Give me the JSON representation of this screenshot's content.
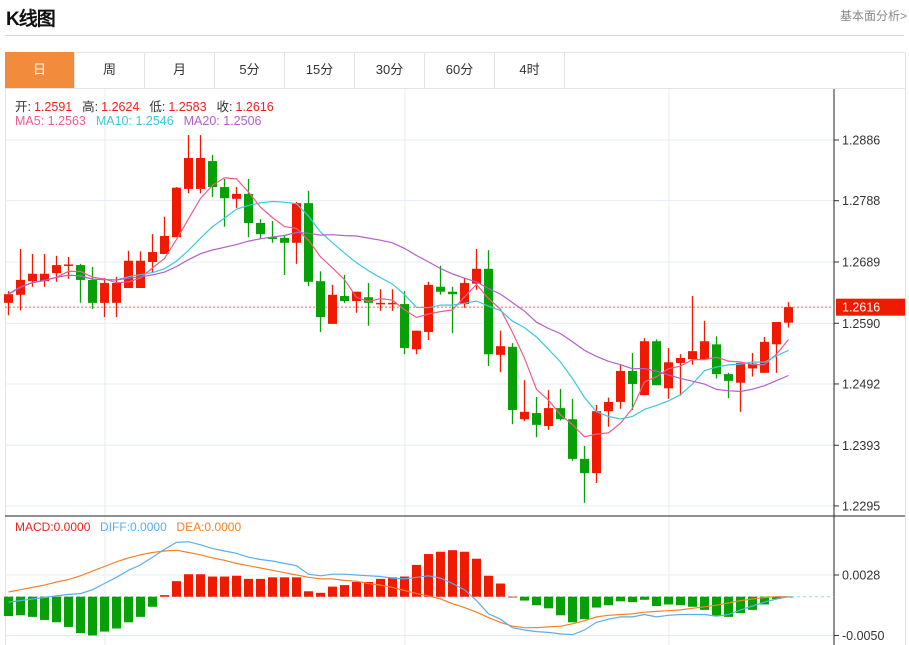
{
  "header": {
    "title": "K线图",
    "more_link": "基本面分析>"
  },
  "tabs": [
    {
      "label": "日",
      "active": true
    },
    {
      "label": "周"
    },
    {
      "label": "月"
    },
    {
      "label": "5分"
    },
    {
      "label": "15分"
    },
    {
      "label": "30分"
    },
    {
      "label": "60分"
    },
    {
      "label": "4时"
    }
  ],
  "ohlc_legend": {
    "open_label": "开:",
    "open": "1.2591",
    "high_label": "高:",
    "high": "1.2624",
    "low_label": "低:",
    "low": "1.2583",
    "close_label": "收:",
    "close": "1.2616"
  },
  "ma_legend": {
    "ma5": "MA5: 1.2563",
    "ma10": "MA10: 1.2546",
    "ma20": "MA20: 1.2506"
  },
  "macd_legend": {
    "macd": "MACD:0.0000",
    "diff": "DIFF:0.0000",
    "dea": "DEA:0.0000"
  },
  "colors": {
    "up": "#f01a00",
    "down": "#07a007",
    "ma5": "#ee5d8c",
    "ma10": "#3cc8dc",
    "ma20": "#b35fc8",
    "diff": "#5aaeef",
    "dea": "#f5822a",
    "accent": "#f38b3c"
  },
  "chart_data": [
    {
      "type": "candlestick",
      "title": "K线图 日",
      "current_price": "1.2616",
      "y_ticks": [
        "1.2886",
        "1.2788",
        "1.2689",
        "1.2590",
        "1.2492",
        "1.2393",
        "1.2295"
      ],
      "ylim": [
        1.2279,
        1.302
      ],
      "ma_periods": [
        5,
        10,
        20
      ],
      "candles": [
        [
          1.2623,
          1.2642,
          1.2603,
          1.2637
        ],
        [
          1.2636,
          1.271,
          1.2611,
          1.266
        ],
        [
          1.2658,
          1.2702,
          1.2649,
          1.267
        ],
        [
          1.2658,
          1.2702,
          1.2649,
          1.267
        ],
        [
          1.2671,
          1.2699,
          1.2657,
          1.2684
        ],
        [
          1.2684,
          1.2697,
          1.2662,
          1.2685
        ],
        [
          1.2684,
          1.2686,
          1.2623,
          1.266
        ],
        [
          1.266,
          1.2681,
          1.2613,
          1.2623
        ],
        [
          1.2623,
          1.2663,
          1.26,
          1.2655
        ],
        [
          1.2623,
          1.2665,
          1.26,
          1.2655
        ],
        [
          1.2647,
          1.2707,
          1.2647,
          1.2691
        ],
        [
          1.2647,
          1.2706,
          1.2647,
          1.2691
        ],
        [
          1.2689,
          1.2734,
          1.2671,
          1.2705
        ],
        [
          1.2702,
          1.2762,
          1.2702,
          1.2731
        ],
        [
          1.2729,
          1.281,
          1.2729,
          1.2809
        ],
        [
          1.2807,
          1.2894,
          1.28,
          1.2857
        ],
        [
          1.2807,
          1.2894,
          1.28,
          1.2857
        ],
        [
          1.2852,
          1.2862,
          1.2794,
          1.281
        ],
        [
          1.281,
          1.2823,
          1.2746,
          1.2792
        ],
        [
          1.2791,
          1.281,
          1.2776,
          1.2799
        ],
        [
          1.2799,
          1.2823,
          1.2729,
          1.2752
        ],
        [
          1.2752,
          1.2758,
          1.2726,
          1.2734
        ],
        [
          1.2729,
          1.2755,
          1.272,
          1.2726
        ],
        [
          1.2728,
          1.2733,
          1.2668,
          1.272
        ],
        [
          1.272,
          1.2786,
          1.2686,
          1.2784
        ],
        [
          1.2784,
          1.2804,
          1.265,
          1.2657
        ],
        [
          1.2658,
          1.2674,
          1.2576,
          1.26
        ],
        [
          1.2589,
          1.2652,
          1.2589,
          1.2636
        ],
        [
          1.2634,
          1.2668,
          1.2623,
          1.2626
        ],
        [
          1.2626,
          1.2641,
          1.2607,
          1.2641
        ],
        [
          1.2632,
          1.2655,
          1.2586,
          1.2623
        ],
        [
          1.2622,
          1.2645,
          1.261,
          1.2623
        ],
        [
          1.2622,
          1.2645,
          1.261,
          1.2623
        ],
        [
          1.2621,
          1.2642,
          1.254,
          1.255
        ],
        [
          1.2548,
          1.2578,
          1.254,
          1.2578
        ],
        [
          1.2576,
          1.2657,
          1.2563,
          1.2652
        ],
        [
          1.2649,
          1.2683,
          1.2636,
          1.2641
        ],
        [
          1.2641,
          1.2649,
          1.2574,
          1.2637
        ],
        [
          1.2621,
          1.2663,
          1.2615,
          1.2655
        ],
        [
          1.2654,
          1.271,
          1.2644,
          1.2678
        ],
        [
          1.2678,
          1.2708,
          1.2521,
          1.254
        ],
        [
          1.2539,
          1.2578,
          1.2511,
          1.2553
        ],
        [
          1.2552,
          1.2558,
          1.2427,
          1.245
        ],
        [
          1.2435,
          1.2498,
          1.2432,
          1.2447
        ],
        [
          1.2445,
          1.2471,
          1.2406,
          1.2426
        ],
        [
          1.2424,
          1.2482,
          1.2418,
          1.2453
        ],
        [
          1.2453,
          1.2484,
          1.2433,
          1.2435
        ],
        [
          1.2435,
          1.2468,
          1.2368,
          1.2371
        ],
        [
          1.2371,
          1.2392,
          1.23,
          1.2348
        ],
        [
          1.2348,
          1.2458,
          1.2332,
          1.2448
        ],
        [
          1.2448,
          1.247,
          1.2423,
          1.2463
        ],
        [
          1.2463,
          1.2524,
          1.2452,
          1.2513
        ],
        [
          1.2513,
          1.2542,
          1.245,
          1.2492
        ],
        [
          1.2474,
          1.2566,
          1.2474,
          1.2561
        ],
        [
          1.2561,
          1.2564,
          1.249,
          1.249
        ],
        [
          1.2485,
          1.255,
          1.2468,
          1.2527
        ],
        [
          1.2526,
          1.254,
          1.2473,
          1.2534
        ],
        [
          1.2532,
          1.2634,
          1.2523,
          1.2545
        ],
        [
          1.2532,
          1.2594,
          1.2532,
          1.2561
        ],
        [
          1.2556,
          1.2569,
          1.2501,
          1.2508
        ],
        [
          1.2508,
          1.251,
          1.2469,
          1.2497
        ],
        [
          1.2494,
          1.2526,
          1.2447,
          1.2526
        ],
        [
          1.2517,
          1.2542,
          1.2504,
          1.2525
        ],
        [
          1.251,
          1.2568,
          1.251,
          1.256
        ],
        [
          1.2556,
          1.2592,
          1.251,
          1.2592
        ],
        [
          1.2591,
          1.2624,
          1.2583,
          1.2616
        ]
      ]
    },
    {
      "type": "bar+line",
      "title": "MACD",
      "y_ticks": [
        "0.0028",
        "-0.0050"
      ],
      "ylim": [
        -0.0052,
        0.0085
      ],
      "macd": [
        -0.0025,
        -0.0024,
        -0.0026,
        -0.003,
        -0.0033,
        -0.0039,
        -0.0047,
        -0.005,
        -0.0045,
        -0.0041,
        -0.0033,
        -0.0026,
        -0.0013,
        0.0002,
        0.002,
        0.0029,
        0.0029,
        0.0026,
        0.0026,
        0.0027,
        0.0023,
        0.0023,
        0.0025,
        0.0025,
        0.0025,
        0.0007,
        0.0005,
        0.0013,
        0.0015,
        0.0019,
        0.0019,
        0.0023,
        0.0025,
        0.0026,
        0.0041,
        0.0055,
        0.0058,
        0.006,
        0.0058,
        0.0049,
        0.0027,
        0.0017,
        0.0,
        -0.0005,
        -0.0011,
        -0.0015,
        -0.0024,
        -0.0033,
        -0.0029,
        -0.0014,
        -0.0011,
        -0.0006,
        -0.0007,
        -0.0004,
        -0.0012,
        -0.001,
        -0.0011,
        -0.0013,
        -0.0017,
        -0.0025,
        -0.0026,
        -0.0021,
        -0.0017,
        -0.001,
        -0.0003,
        -0.0001
      ],
      "diff": [
        -0.0007,
        -0.0005,
        -0.0003,
        -0.0001,
        0.0001,
        0.0003,
        0.0004,
        0.0009,
        0.0017,
        0.0025,
        0.0034,
        0.0041,
        0.0051,
        0.0061,
        0.007,
        0.0071,
        0.0067,
        0.0062,
        0.0059,
        0.0056,
        0.0051,
        0.0048,
        0.0046,
        0.0043,
        0.004,
        0.0029,
        0.0027,
        0.0029,
        0.0029,
        0.0028,
        0.0027,
        0.0026,
        0.0024,
        0.0023,
        0.0025,
        0.0027,
        0.0024,
        0.0017,
        0.0009,
        -0.0005,
        -0.0022,
        -0.0029,
        -0.004,
        -0.0043,
        -0.0045,
        -0.0046,
        -0.0048,
        -0.0049,
        -0.0043,
        -0.0033,
        -0.0029,
        -0.0026,
        -0.0026,
        -0.0023,
        -0.0026,
        -0.0024,
        -0.0023,
        -0.0023,
        -0.0023,
        -0.0025,
        -0.0023,
        -0.0017,
        -0.0012,
        -0.0007,
        -0.0003,
        0.0
      ],
      "dea": [
        0.0006,
        0.0009,
        0.0012,
        0.0015,
        0.0019,
        0.0022,
        0.0027,
        0.0033,
        0.0039,
        0.0045,
        0.005,
        0.0054,
        0.0057,
        0.0059,
        0.006,
        0.0057,
        0.0054,
        0.005,
        0.0047,
        0.0043,
        0.004,
        0.0037,
        0.0034,
        0.0031,
        0.0028,
        0.0025,
        0.0023,
        0.0023,
        0.0021,
        0.002,
        0.0017,
        0.0015,
        0.0012,
        0.0008,
        0.0004,
        0.0001,
        -0.0003,
        -0.0009,
        -0.0014,
        -0.002,
        -0.0027,
        -0.0033,
        -0.0038,
        -0.004,
        -0.004,
        -0.0039,
        -0.0038,
        -0.0035,
        -0.0031,
        -0.0026,
        -0.0024,
        -0.0023,
        -0.0022,
        -0.002,
        -0.0019,
        -0.0018,
        -0.0017,
        -0.0015,
        -0.0013,
        -0.0011,
        -0.0008,
        -0.0005,
        -0.0003,
        -0.0001,
        0.0,
        0.0
      ]
    }
  ]
}
